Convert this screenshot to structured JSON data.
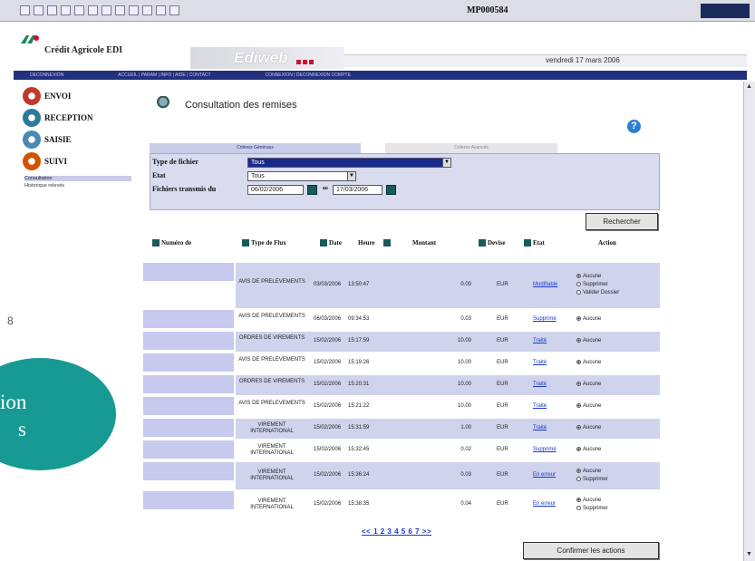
{
  "window": {
    "title": "MP000584"
  },
  "bank": {
    "name": "Crédit Agricole EDI",
    "app": "Ediweb",
    "date": "vendredi 17 mars 2006"
  },
  "nav": {
    "items": [
      "DECONNEXION",
      "ACCUEIL | PARAM | INFO | AIDE | CONTACT",
      "CONNEXION | DECONNEXION COMPTE"
    ]
  },
  "sidebar": {
    "items": [
      {
        "label": "ENVOI",
        "icon": "envoi-icon",
        "color": "#c0392b"
      },
      {
        "label": "RECEPTION",
        "icon": "reception-icon",
        "color": "#2c7a9a"
      },
      {
        "label": "SAISIE",
        "icon": "saisie-icon",
        "color": "#4a8ab0"
      },
      {
        "label": "SUIVI",
        "icon": "suivi-icon",
        "color": "#d35400"
      }
    ],
    "subitems": [
      "Consultation",
      "Historique relevés"
    ]
  },
  "overlay": {
    "line1": "ion",
    "line2": "s"
  },
  "page": {
    "title": "Consultation des remises",
    "help": "?"
  },
  "tabs": {
    "active": "Critères Généraux",
    "inactive": "Critères Avancés"
  },
  "filters": {
    "type_label": "Type de fichier",
    "type_value": "Tous",
    "etat_label": "Etat",
    "etat_value": "Tous",
    "date_label": "Fichiers transmis du",
    "date_from": "06/02/2006",
    "au_label": "au",
    "date_to": "17/03/2006"
  },
  "buttons": {
    "search": "Rechercher",
    "confirm": "Confirmer les actions"
  },
  "table": {
    "headers": {
      "numero": "Numéro de",
      "type": "Type de Flux",
      "date": "Date",
      "heure": "Heure",
      "montant": "Montant",
      "devise": "Devise",
      "etat": "Etat",
      "action": "Action"
    },
    "rows": [
      {
        "type": "AVIS DE PRELEVEMENTS",
        "date": "03/03/2006",
        "heure": "13:50:47",
        "montant": "0.00",
        "devise": "EUR",
        "etat": "Modifiable",
        "actions": [
          "Aucune",
          "Supprimer",
          "Valider Dossier"
        ]
      },
      {
        "type": "AVIS DE PRELEVEMENTS",
        "date": "06/03/2006",
        "heure": "09:34:53",
        "montant": "0.03",
        "devise": "EUR",
        "etat": "Supprimé",
        "actions": [
          "Aucune"
        ]
      },
      {
        "type": "ORDRES DE VIREMENTS",
        "date": "15/02/2006",
        "heure": "15:17:59",
        "montant": "10.00",
        "devise": "EUR",
        "etat": "Traité",
        "actions": [
          "Aucune"
        ]
      },
      {
        "type": "AVIS DE PRELEVEMENTS",
        "date": "15/02/2006",
        "heure": "15:19:26",
        "montant": "10.00",
        "devise": "EUR",
        "etat": "Traité",
        "actions": [
          "Aucune"
        ]
      },
      {
        "type": "ORDRES DE VIREMENTS",
        "date": "15/02/2006",
        "heure": "15:20:31",
        "montant": "10.00",
        "devise": "EUR",
        "etat": "Traité",
        "actions": [
          "Aucune"
        ]
      },
      {
        "type": "AVIS DE PRELEVEMENTS",
        "date": "15/02/2006",
        "heure": "15:21:22",
        "montant": "10.00",
        "devise": "EUR",
        "etat": "Traité",
        "actions": [
          "Aucune"
        ]
      },
      {
        "type": "VIREMENT INTERNATIONAL",
        "date": "15/02/2006",
        "heure": "15:31:59",
        "montant": "1.00",
        "devise": "EUR",
        "etat": "Traité",
        "actions": [
          "Aucune"
        ]
      },
      {
        "type": "VIREMENT INTERNATIONAL",
        "date": "15/02/2006",
        "heure": "15:32:45",
        "montant": "0.02",
        "devise": "EUR",
        "etat": "Supprimé",
        "actions": [
          "Aucune"
        ]
      },
      {
        "type": "VIREMENT INTERNATIONAL",
        "date": "15/02/2006",
        "heure": "15:36:24",
        "montant": "0.03",
        "devise": "EUR",
        "etat": "En erreur",
        "actions": [
          "Aucune",
          "Supprimer"
        ]
      },
      {
        "type": "VIREMENT INTERNATIONAL",
        "date": "15/02/2006",
        "heure": "15:38:35",
        "montant": "0.04",
        "devise": "EUR",
        "etat": "En erreur",
        "actions": [
          "Aucune",
          "Supprimer"
        ]
      }
    ]
  },
  "pager": "<< 1 2 3 4 5 6 7 >>"
}
